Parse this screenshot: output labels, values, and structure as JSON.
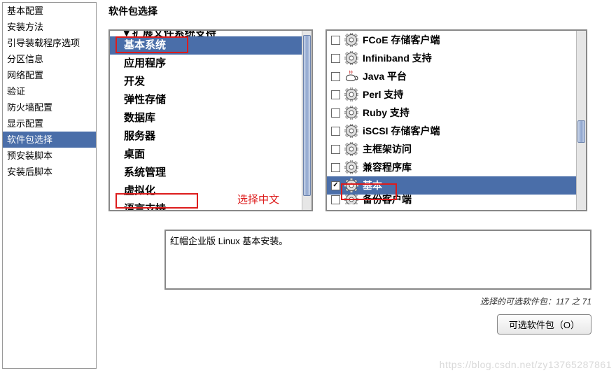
{
  "sidebar": {
    "items": [
      {
        "label": "基本配置"
      },
      {
        "label": "安装方法"
      },
      {
        "label": "引导装载程序选项"
      },
      {
        "label": "分区信息"
      },
      {
        "label": "网络配置"
      },
      {
        "label": "验证"
      },
      {
        "label": "防火墙配置"
      },
      {
        "label": "显示配置"
      },
      {
        "label": "软件包选择",
        "selected": true
      },
      {
        "label": "预安装脚本"
      },
      {
        "label": "安装后脚本"
      }
    ]
  },
  "content": {
    "title": "软件包选择"
  },
  "categories": {
    "cutoff_top": "▾ 扩展文件系统支持",
    "items": [
      {
        "label": "基本系统",
        "selected": true,
        "redbox": true
      },
      {
        "label": "应用程序"
      },
      {
        "label": "开发"
      },
      {
        "label": "弹性存储"
      },
      {
        "label": "数据库"
      },
      {
        "label": "服务器"
      },
      {
        "label": "桌面"
      },
      {
        "label": "系统管理"
      },
      {
        "label": "虚拟化"
      },
      {
        "label": "语言支持",
        "redbox": true
      }
    ]
  },
  "packages": {
    "items": [
      {
        "label": "FCoE 存储客户端",
        "checked": false,
        "icon": "gear"
      },
      {
        "label": "Infiniband 支持",
        "checked": false,
        "icon": "gear"
      },
      {
        "label": "Java 平台",
        "checked": false,
        "icon": "java"
      },
      {
        "label": "Perl 支持",
        "checked": false,
        "icon": "gear"
      },
      {
        "label": "Ruby 支持",
        "checked": false,
        "icon": "gear"
      },
      {
        "label": "iSCSI 存储客户端",
        "checked": false,
        "icon": "gear"
      },
      {
        "label": "主框架访问",
        "checked": false,
        "icon": "gear"
      },
      {
        "label": "兼容程序库",
        "checked": false,
        "icon": "gear"
      },
      {
        "label": "基本",
        "checked": true,
        "icon": "gear",
        "selected": true,
        "redbox": true
      },
      {
        "label": "备份客户端",
        "checked": false,
        "icon": "gear",
        "cutoff": true
      }
    ]
  },
  "annotations": {
    "choose_cn": "选择中文"
  },
  "description": "红帽企业版 Linux 基本安装。",
  "count_line": "选择的可选软件包：117 之 71",
  "optional_button": "可选软件包（O）",
  "watermark": "https://blog.csdn.net/zy13765287861"
}
